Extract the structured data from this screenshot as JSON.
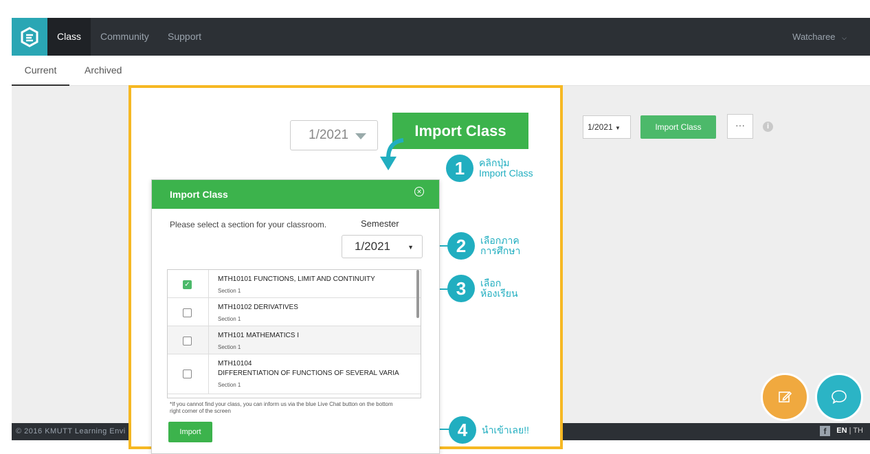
{
  "nav": {
    "items": [
      "Class",
      "Community",
      "Support"
    ],
    "user": "Watcharee"
  },
  "subtabs": [
    "Current",
    "Archived"
  ],
  "toolbar": {
    "semester": "1/2021",
    "import_label": "Import Class",
    "more_label": "···",
    "info_label": "i"
  },
  "tutorial": {
    "semester_value": "1/2021",
    "import_label": "Import Class",
    "steps": [
      {
        "num": "1",
        "lines": [
          "คลิกปุ่ม",
          "Import Class"
        ]
      },
      {
        "num": "2",
        "lines": [
          "เลือกภาค",
          "การศึกษา"
        ]
      },
      {
        "num": "3",
        "lines": [
          "เลือก",
          "ห้องเรียน"
        ]
      },
      {
        "num": "4",
        "lines": [
          "นำเข้าเลย!!"
        ]
      }
    ]
  },
  "dialog": {
    "title": "Import Class",
    "prompt": "Please select a section for your classroom.",
    "semester_label": "Semester",
    "semester_value": "1/2021",
    "courses": [
      {
        "name": "MTH10101 FUNCTIONS, LIMIT AND CONTINUITY",
        "section": "Section 1",
        "checked": true
      },
      {
        "name": "MTH10102 DERIVATIVES",
        "section": "Section 1",
        "checked": false
      },
      {
        "name": "MTH101 MATHEMATICS I",
        "section": "Section 1",
        "checked": false
      },
      {
        "name": "MTH10104",
        "name2": "DIFFERENTIATION OF FUNCTIONS OF SEVERAL VARIA",
        "section": "Section 1",
        "checked": false
      }
    ],
    "note": "*If you cannot find your class, you can inform us via the blue Live Chat button on the bottom right corner of the screen",
    "import_button": "Import"
  },
  "footer": {
    "copyright": "© 2016 KMUTT Learning Envi",
    "lang_en": "EN",
    "lang_sep": "|",
    "lang_th": "TH"
  },
  "colors": {
    "accent_teal": "#21aec0",
    "brand_green": "#3cb34c",
    "highlight_yellow": "#f6b823",
    "navbar": "#2c3035"
  }
}
